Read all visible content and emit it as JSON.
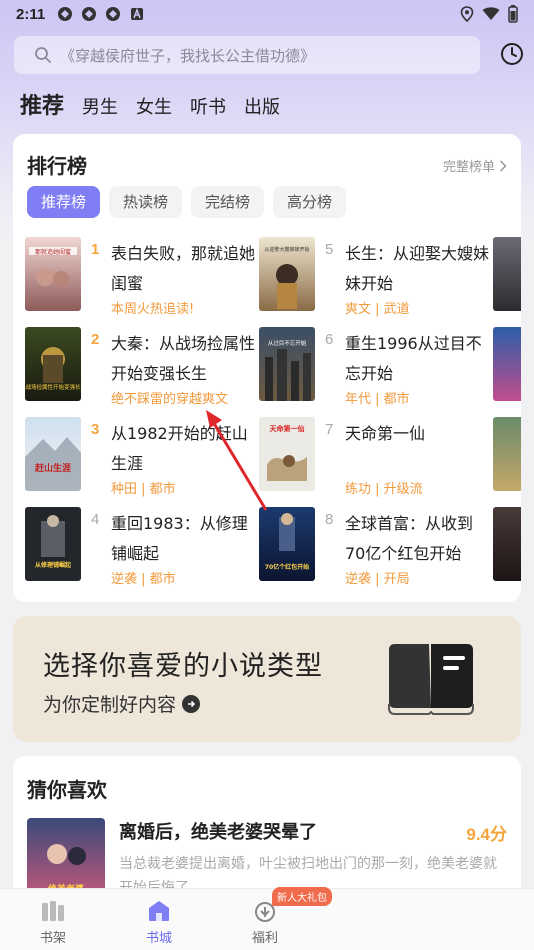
{
  "status_bar": {
    "time": "2:11"
  },
  "search": {
    "placeholder": "《穿越侯府世子，我找长公主借功德》"
  },
  "channels": [
    "推荐",
    "男生",
    "女生",
    "听书",
    "出版"
  ],
  "ranking": {
    "title": "排行榜",
    "more_label": "完整榜单",
    "tabs": [
      "推荐榜",
      "热读榜",
      "完结榜",
      "高分榜"
    ],
    "books": [
      {
        "rank": "1",
        "title": "表白失败，那就追她闺蜜",
        "tags": "本周火热追读!"
      },
      {
        "rank": "2",
        "title": "大秦：从战场捡属性开始变强长生",
        "tags": "绝不踩雷的穿越爽文"
      },
      {
        "rank": "3",
        "title": "从1982开始的赶山生涯",
        "tags": "种田 | 都市"
      },
      {
        "rank": "4",
        "title": "重回1983：从修理铺崛起",
        "tags": "逆袭 | 都市"
      },
      {
        "rank": "5",
        "title": "长生：从迎娶大嫂妹妹开始",
        "tags": "爽文 | 武道"
      },
      {
        "rank": "6",
        "title": "重生1996从过目不忘开始",
        "tags": "年代 | 都市"
      },
      {
        "rank": "7",
        "title": "天命第一仙",
        "tags": "练功 | 升级流"
      },
      {
        "rank": "8",
        "title": "全球首富：从收到70亿个红包开始",
        "tags": "逆袭 | 开局"
      }
    ],
    "cover_texts": {
      "c1": "那就追她闺蜜",
      "c2": "从战场捡属性开始变强长生",
      "c3": "赶山生涯",
      "c4": "从修理铺崛起",
      "c5": "从迎娶大嫂妹妹开始",
      "c6": "从过目不忘开始",
      "c7": "天命第一仙",
      "c8": "70亿个红包开始"
    }
  },
  "banner": {
    "title": "选择你喜爱的小说类型",
    "subtitle": "为你定制好内容"
  },
  "guess": {
    "title": "猜你喜欢",
    "book": {
      "title": "离婚后，绝美老婆哭晕了",
      "score": "9.4分",
      "desc": "当总裁老婆提出离婚，叶尘被扫地出门的那一刻，绝美老婆就开始后悔了...",
      "cover_text": "绝美老婆"
    }
  },
  "bottom_nav": {
    "items": [
      {
        "label": "书架",
        "icon": "bookshelf-icon"
      },
      {
        "label": "书城",
        "icon": "bookstore-icon"
      },
      {
        "label": "福利",
        "icon": "gift-icon"
      }
    ],
    "badge": "新人大礼包"
  },
  "colors": {
    "accent": "#7f7ef5",
    "rank_top": "#f4a53b",
    "tag": "#f29a3c",
    "annotation_arrow": "#e0272b"
  }
}
